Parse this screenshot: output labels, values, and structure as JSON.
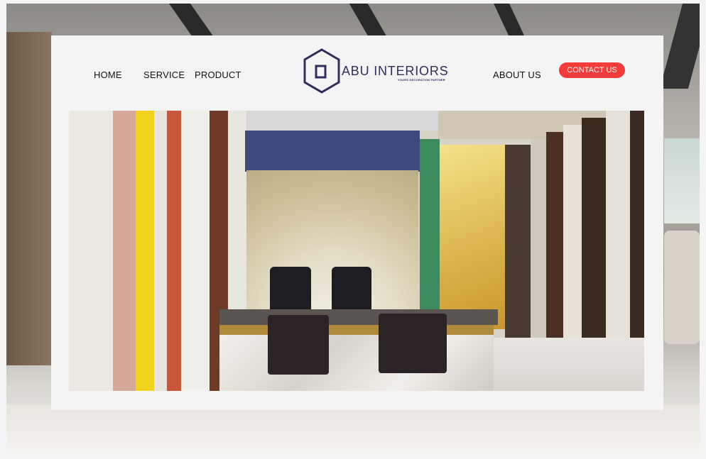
{
  "nav": {
    "home": "HOME",
    "service": "SERVICE",
    "product": "PRODUCT",
    "about": "ABOUT US",
    "contact": "CONTACT US"
  },
  "logo": {
    "name": "ABU INTERIORS",
    "tagline": "YOURS DECORATION PARTNER",
    "icon": "house-hexagon-icon"
  },
  "colors": {
    "accent": "#f23b3b",
    "brand": "#2e2e5c",
    "panel": "#f4f4f4"
  }
}
